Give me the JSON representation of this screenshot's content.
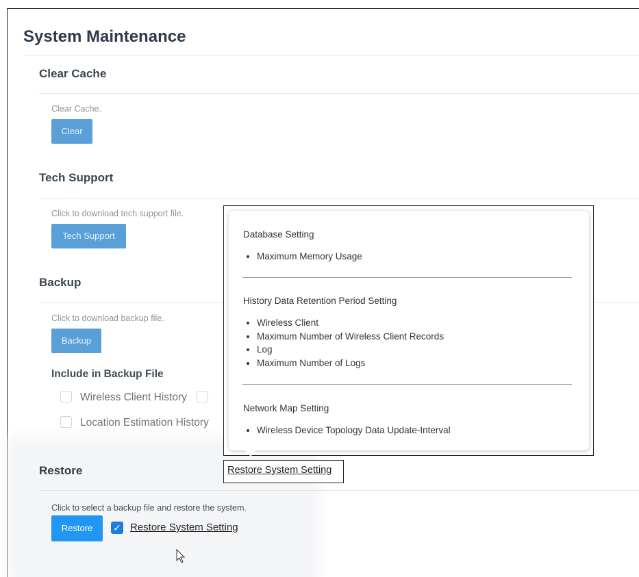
{
  "page": {
    "title": "System Maintenance"
  },
  "clear_cache": {
    "title": "Clear Cache",
    "description": "Clear Cache.",
    "button": "Clear"
  },
  "tech_support": {
    "title": "Tech Support",
    "description": "Click to download tech support file.",
    "button": "Tech Support"
  },
  "backup": {
    "title": "Backup",
    "description": "Click to download backup file.",
    "button": "Backup",
    "include_title": "Include in Backup File",
    "options": [
      {
        "label": "Wireless Client History",
        "checked": false
      },
      {
        "label": "Location Estimation History",
        "checked": false
      }
    ]
  },
  "restore": {
    "title": "Restore",
    "description": "Click to select a backup file and restore the system.",
    "button": "Restore",
    "checkbox_label": "Restore System Setting",
    "checkbox_checked": true
  },
  "tooltip": {
    "sections": [
      {
        "title": "Database Setting",
        "items": [
          "Maximum Memory Usage"
        ]
      },
      {
        "title": "History Data Retention Period Setting",
        "items": [
          "Wireless Client",
          "Maximum Number of Wireless Client Records",
          "Log",
          "Maximum Number of Logs"
        ]
      },
      {
        "title": "Network Map Setting",
        "items": [
          "Wireless Device Topology Data Update-Interval"
        ]
      }
    ],
    "target_label": "Restore System Setting"
  },
  "colors": {
    "primary_button": "#2196f3",
    "disabled_button": "#5aa0d8",
    "checkbox": "#1e7be0"
  }
}
